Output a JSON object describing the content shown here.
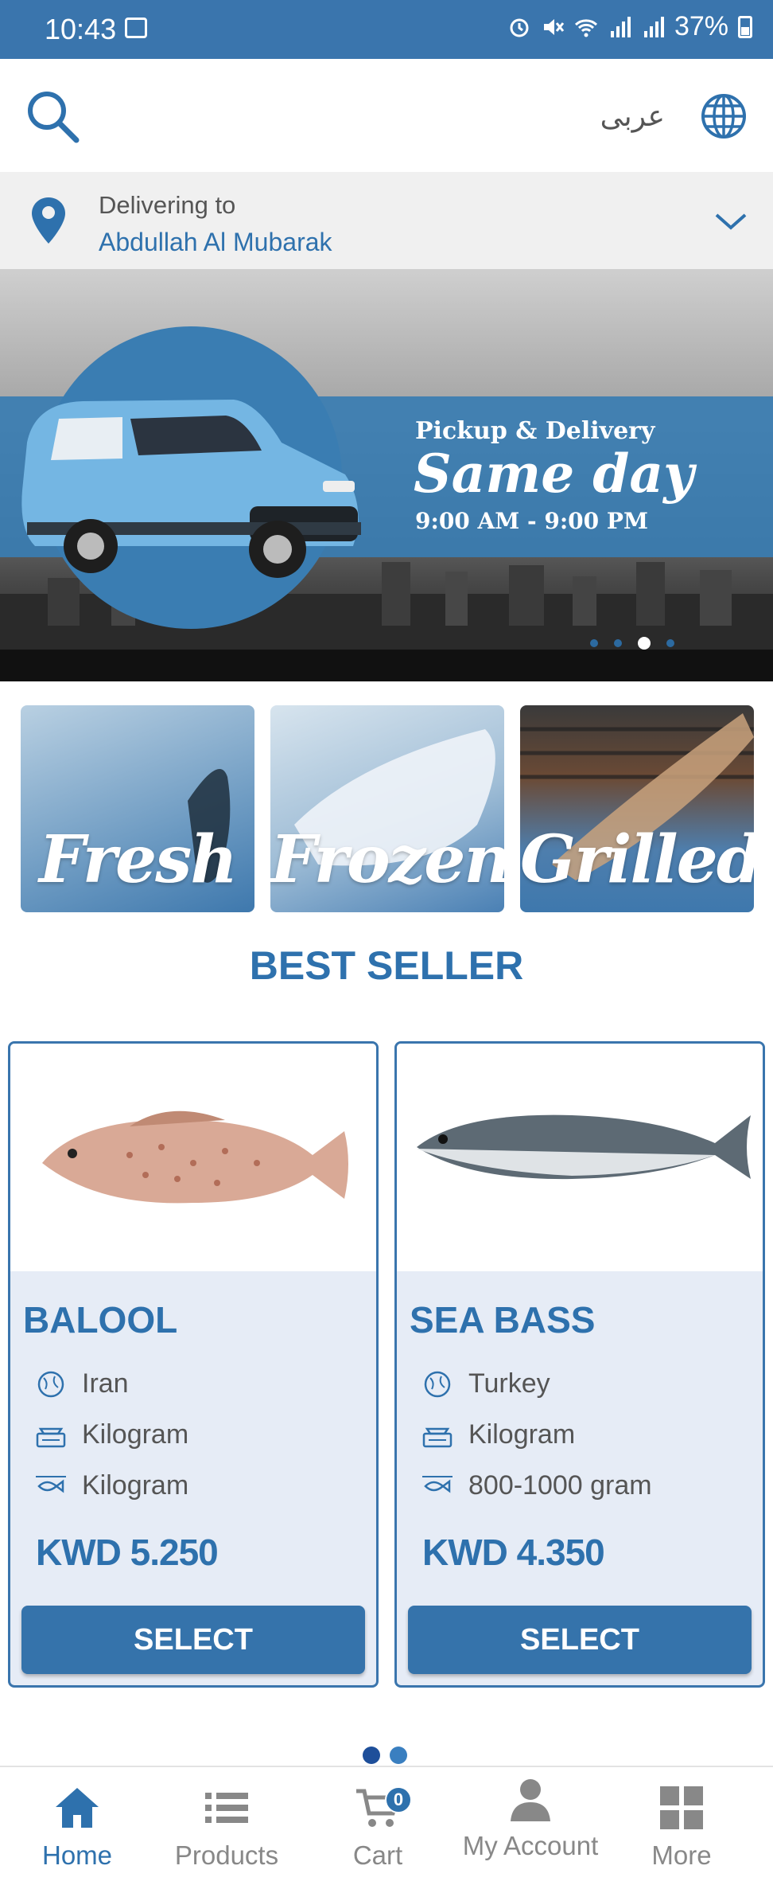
{
  "status_bar": {
    "time": "10:43",
    "battery": "37%"
  },
  "header": {
    "language_label": "عربى"
  },
  "delivery": {
    "label": "Delivering to",
    "address": "Abdullah Al Mubarak"
  },
  "banner": {
    "line1": "Pickup & Delivery",
    "line2": "Same day",
    "line3": "9:00 AM - 9:00 PM",
    "slide_count": 4,
    "active_slide": 3
  },
  "categories": [
    {
      "label": "Fresh"
    },
    {
      "label": "Frozen"
    },
    {
      "label": "Grilled"
    }
  ],
  "best_seller": {
    "title": "BEST SELLER"
  },
  "products": [
    {
      "name": "BALOOL",
      "origin": "Iran",
      "unit": "Kilogram",
      "size": "Kilogram",
      "price": "KWD 5.250",
      "button": "SELECT"
    },
    {
      "name": "SEA BASS",
      "origin": "Turkey",
      "unit": "Kilogram",
      "size": "800-1000 gram",
      "price": "KWD 4.350",
      "button": "SELECT"
    }
  ],
  "bottom_nav": {
    "items": [
      {
        "label": "Home",
        "icon": "home-icon",
        "active": true
      },
      {
        "label": "Products",
        "icon": "list-icon",
        "active": false
      },
      {
        "label": "Cart",
        "icon": "cart-icon",
        "active": false,
        "badge": "0"
      },
      {
        "label": "My Account",
        "icon": "user-icon",
        "active": false
      },
      {
        "label": "More",
        "icon": "grid-icon",
        "active": false
      }
    ]
  },
  "colors": {
    "brand_blue": "#3a75ad",
    "text_blue": "#2e71ad",
    "card_bg": "#e6ecf6",
    "nav_inactive": "#888888"
  }
}
